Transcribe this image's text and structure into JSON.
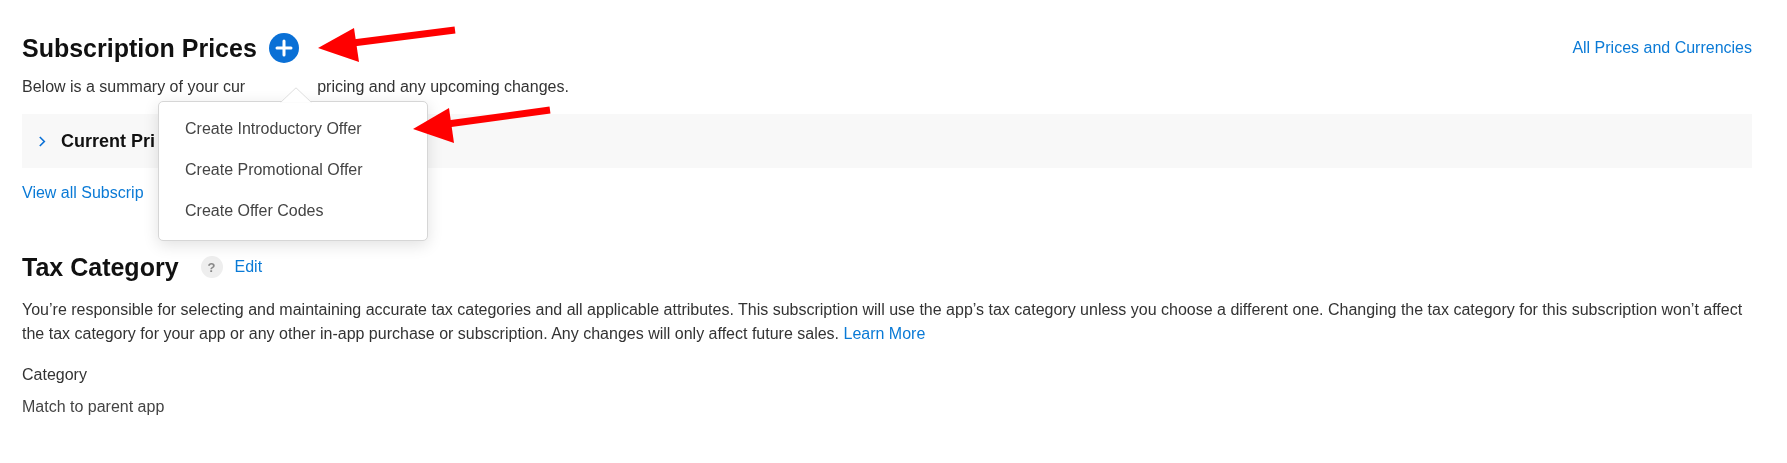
{
  "prices": {
    "title": "Subscription Prices",
    "link": "All Prices and Currencies",
    "description_before": "Below is a summary of your cur",
    "description_after": "pricing and any upcoming changes.",
    "current_row": {
      "label": "Current Pri",
      "expanded": false
    },
    "view_all": "View all Subscrip"
  },
  "menu": {
    "items": [
      {
        "label": "Create Introductory Offer"
      },
      {
        "label": "Create Promotional Offer"
      },
      {
        "label": "Create Offer Codes"
      }
    ]
  },
  "tax": {
    "title": "Tax Category",
    "help": "?",
    "edit": "Edit",
    "text": "You’re responsible for selecting and maintaining accurate tax categories and all applicable attributes. This subscription will use the app’s tax category unless you choose a different one. Changing the tax category for this subscription won’t affect the tax category for your app or any other in-app purchase or subscription. Any changes will only affect future sales.",
    "learn_more": "Learn More",
    "field_label": "Category",
    "field_value": "Match to parent app"
  }
}
